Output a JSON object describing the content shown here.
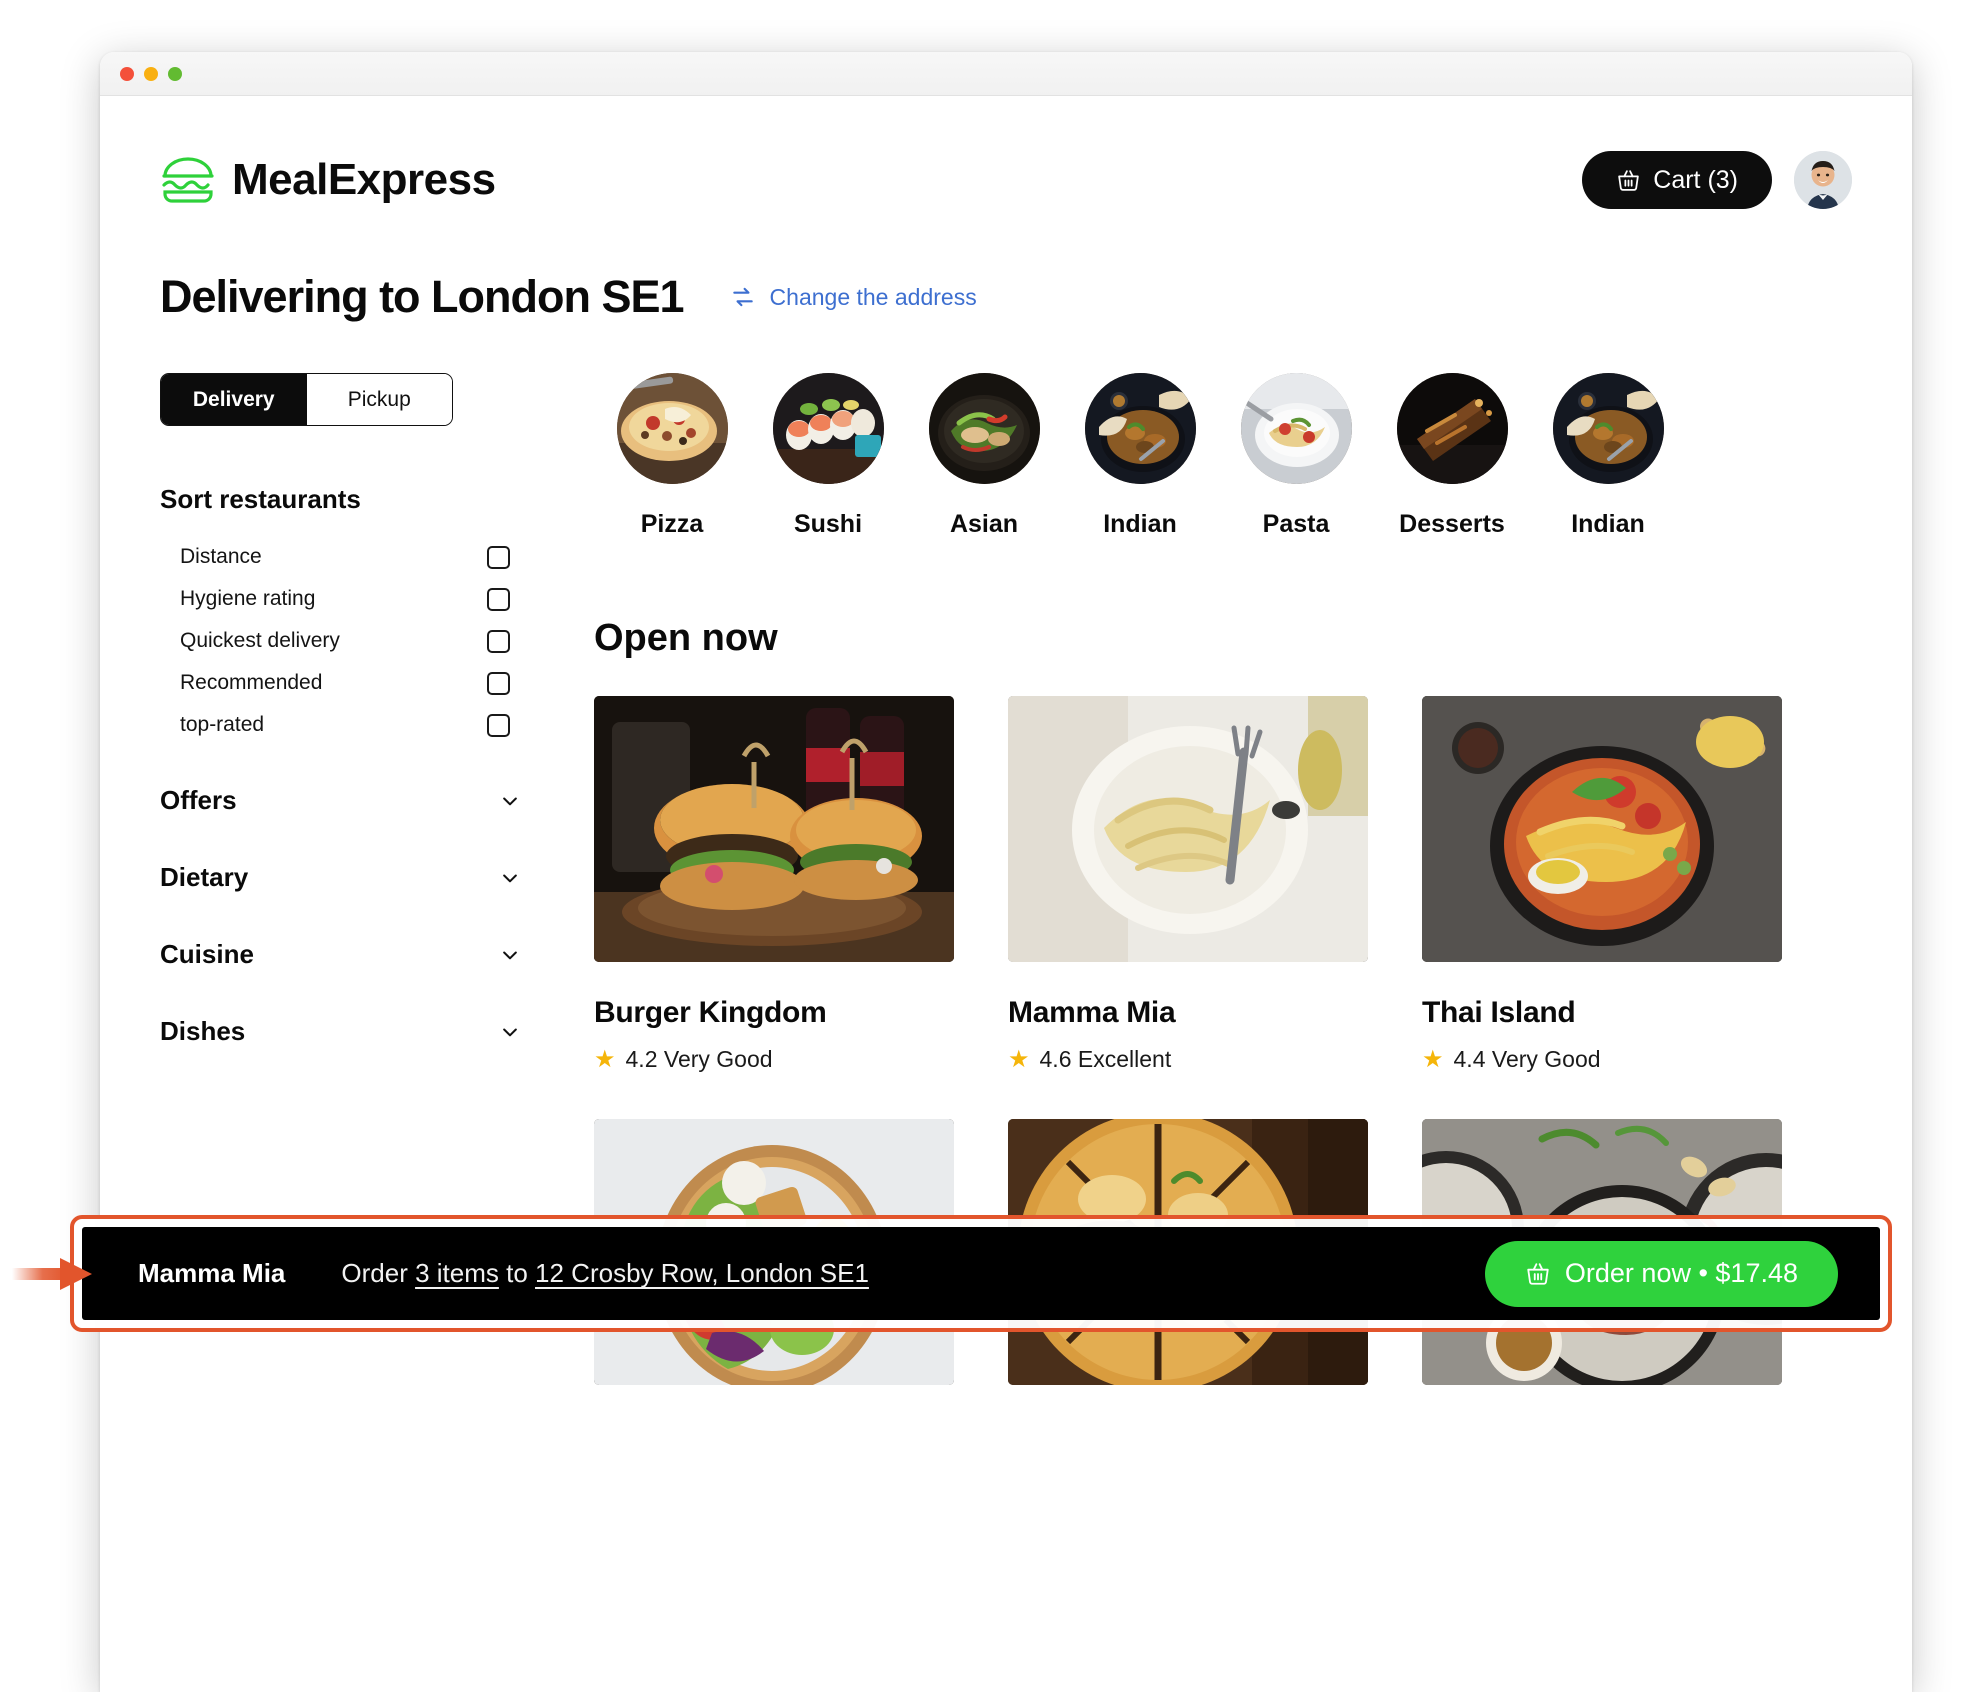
{
  "window": {
    "traffic_lights": [
      "close",
      "minimize",
      "maximize"
    ]
  },
  "header": {
    "brand_name": "MealExpress",
    "logo_icon": "burger-icon",
    "cart_label": "Cart (3)",
    "cart_icon": "basket-icon",
    "avatar_icon": "user-avatar"
  },
  "delivery": {
    "title": "Delivering to London SE1",
    "change_address_label": "Change the address",
    "change_address_icon": "swap-arrows-icon"
  },
  "sidebar": {
    "mode_toggle": {
      "options": [
        {
          "label": "Delivery",
          "active": true
        },
        {
          "label": "Pickup",
          "active": false
        }
      ]
    },
    "sort_title": "Sort restaurants",
    "sort_options": [
      {
        "label": "Distance",
        "checked": false
      },
      {
        "label": "Hygiene rating",
        "checked": false
      },
      {
        "label": "Quickest delivery",
        "checked": false
      },
      {
        "label": "Recommended",
        "checked": false
      },
      {
        "label": "top-rated",
        "checked": false
      }
    ],
    "accordions": [
      {
        "label": "Offers",
        "icon": "chevron-down-icon"
      },
      {
        "label": "Dietary",
        "icon": "chevron-down-icon"
      },
      {
        "label": "Cuisine",
        "icon": "chevron-down-icon"
      },
      {
        "label": "Dishes",
        "icon": "chevron-down-icon"
      }
    ]
  },
  "categories": [
    {
      "label": "Pizza"
    },
    {
      "label": "Sushi"
    },
    {
      "label": "Asian"
    },
    {
      "label": "Indian"
    },
    {
      "label": "Pasta"
    },
    {
      "label": "Desserts"
    },
    {
      "label": "Indian"
    }
  ],
  "content": {
    "section_title": "Open now",
    "restaurants": [
      {
        "name": "Burger Kingdom",
        "rating": "4.2 Very Good",
        "star_icon": "star-icon"
      },
      {
        "name": "Mamma Mia",
        "rating": "4.6 Excellent",
        "star_icon": "star-icon"
      },
      {
        "name": "Thai Island",
        "rating": "4.4 Very Good",
        "star_icon": "star-icon"
      }
    ]
  },
  "order_bar": {
    "restaurant": "Mamma Mia",
    "order_prefix": "Order ",
    "items_link": "3 items",
    "order_middle": " to ",
    "address_link": "12 Crosby Row, London SE1",
    "button_label": "Order now • $17.48",
    "button_icon": "basket-icon"
  },
  "colors": {
    "brand_green": "#2ed13a",
    "accent_green": "#2fd23d",
    "link_blue": "#3d6fd0",
    "highlight_orange": "#e2552c",
    "black": "#0d0d0d",
    "star_yellow": "#f5b50a"
  }
}
